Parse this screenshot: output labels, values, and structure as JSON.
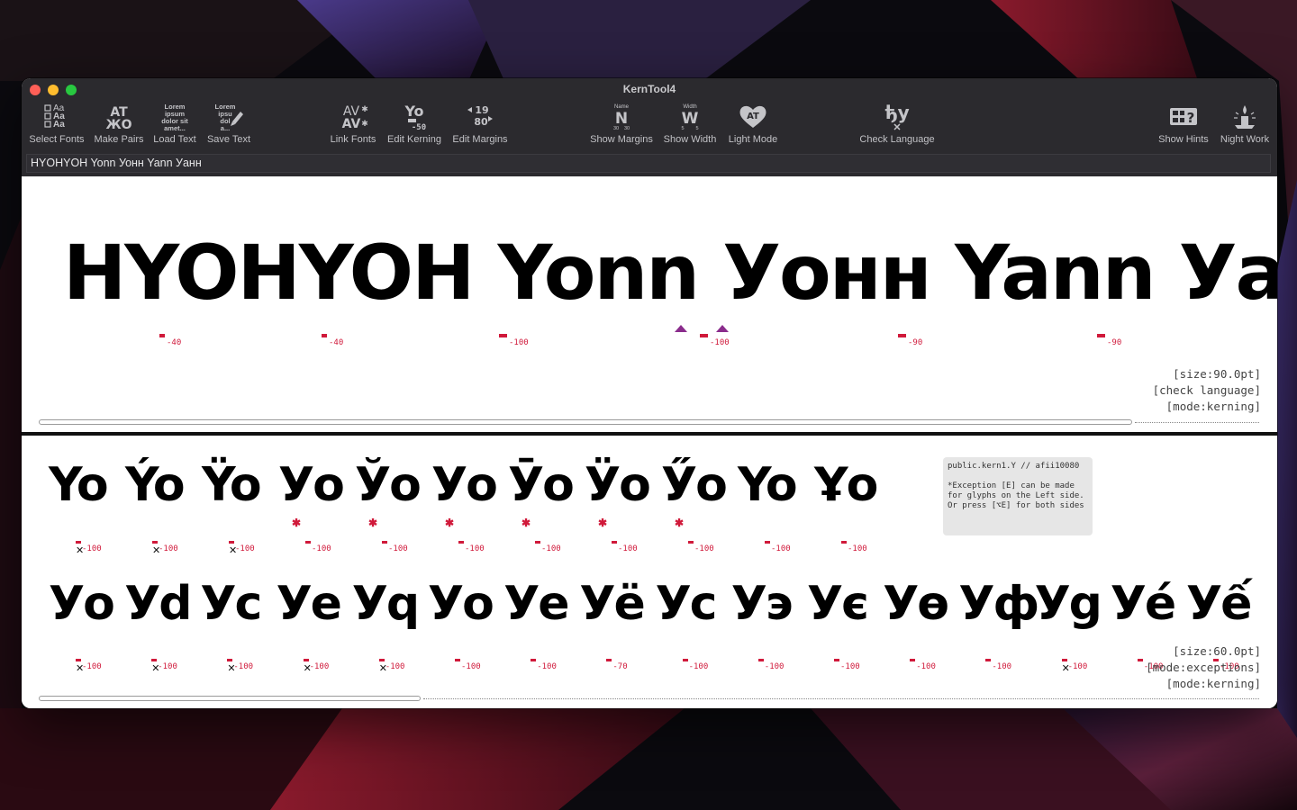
{
  "window": {
    "title": "KernTool4"
  },
  "toolbar": {
    "select_fonts": "Select Fonts",
    "make_pairs": "Make Pairs",
    "load_text": "Load Text",
    "save_text": "Save Text",
    "link_fonts": "Link Fonts",
    "edit_kerning": "Edit Kerning",
    "edit_margins": "Edit Margins",
    "show_margins": "Show Margins",
    "show_width": "Show Width",
    "light_mode": "Light Mode",
    "check_language": "Check Language",
    "show_hints": "Show Hints",
    "night_work": "Night Work",
    "icon_text": {
      "select_fonts": [
        "Aa",
        "Aa",
        "Aa"
      ],
      "make_pairs": [
        "AT",
        "ЖО"
      ],
      "load_text": [
        "Lorem",
        "ipsum",
        "dolor sit",
        "amet..."
      ],
      "save_text": [
        "Lorem",
        "ipsu",
        "dol",
        "a..."
      ],
      "link_fonts": [
        "AV",
        "AV"
      ],
      "edit_kerning": [
        "Yo",
        "-50"
      ],
      "edit_margins": [
        "19",
        "80"
      ],
      "show_margins": [
        "Name",
        "N",
        "30",
        "30"
      ],
      "show_width": [
        "Width",
        "W",
        "5",
        "5"
      ],
      "light_mode": "AT",
      "check_language": "ђу",
      "show_hints": "?"
    }
  },
  "text_input": {
    "value": "HYOHYOH Yonn Уонн Yann Уанн"
  },
  "panel_top": {
    "display_text": "HYOHYOH Yonn Уонн Yann Уанн",
    "kern_values": [
      "-40",
      "-40",
      "-100",
      "-100",
      "-90",
      "-90"
    ],
    "status": [
      "[size:90.0pt]",
      "[check language]",
      "[mode:kerning]"
    ]
  },
  "panel_bottom": {
    "row1_pairs": [
      "Yo",
      "Ýo",
      "Ÿo",
      "Уo",
      "Ўo",
      "Уo",
      "Ӯo",
      "Ӱo",
      "Ӳo",
      "Yo",
      "Ұo"
    ],
    "row1_values": [
      "-100",
      "-100",
      "-100",
      "-100",
      "-100",
      "-100",
      "-100",
      "-100",
      "-100",
      "-100",
      "-100"
    ],
    "row2_pairs": [
      "Уo",
      "Уd",
      "Уc",
      "Уe",
      "Уq",
      "Уо",
      "Уе",
      "Уё",
      "Ус",
      "Уэ",
      "Ує",
      "Уө",
      "Уф",
      "Уg",
      "Уé",
      "Уế"
    ],
    "row2_values": [
      "-100",
      "-100",
      "-100",
      "-100",
      "-100",
      "-100",
      "-100",
      "-70",
      "-100",
      "-100",
      "-100",
      "-100",
      "-100",
      "-100",
      "-100",
      "-100"
    ],
    "info": "public.kern1.Y // afii10080\n\n*Exception [E] can be made\nfor glyphs on the Left side.\nOr press [⌥E] for both sides",
    "status": [
      "[size:60.0pt]",
      "[mode:exceptions]",
      "[mode:kerning]"
    ]
  },
  "colors": {
    "accent_red": "#d0193a",
    "accent_purple": "#8a2c8c",
    "titlebar": "#2b2a2e",
    "close": "#ff5f57",
    "minimize": "#febc2e",
    "zoom": "#28c840"
  }
}
